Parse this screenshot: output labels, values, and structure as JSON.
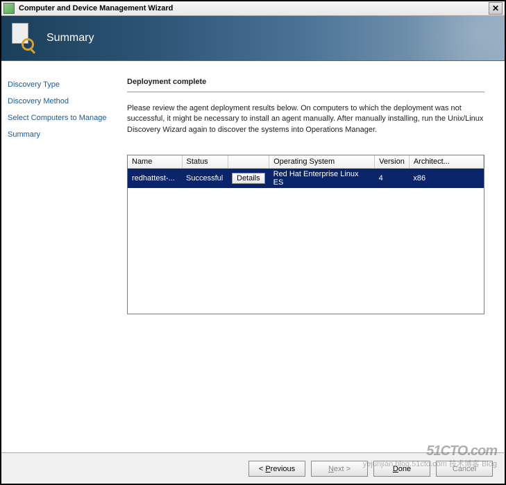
{
  "titlebar": {
    "text": "Computer and Device Management Wizard"
  },
  "header": {
    "title": "Summary"
  },
  "sidebar": {
    "items": [
      {
        "label": "Discovery Type"
      },
      {
        "label": "Discovery Method"
      },
      {
        "label": "Select Computers to Manage"
      },
      {
        "label": "Summary"
      }
    ]
  },
  "main": {
    "section_title": "Deployment complete",
    "description": "Please review the agent deployment results below. On computers to which the deployment was not successful, it might be necessary to install an agent manually. After manually installing, run the Unix/Linux Discovery Wizard again to discover the systems into Operations Manager.",
    "table": {
      "headers": {
        "name": "Name",
        "status": "Status",
        "spacer": "",
        "os": "Operating System",
        "version": "Version",
        "arch": "Architect..."
      },
      "rows": [
        {
          "name": "redhattest-...",
          "status": "Successful",
          "details_label": "Details",
          "os": "Red Hat Enterprise Linux ES",
          "version": "4",
          "arch": "x86"
        }
      ]
    }
  },
  "buttons": {
    "previous": "< Previous",
    "next": "Next >",
    "done": "Done",
    "cancel": "Cancel"
  },
  "labels": {
    "p_char": "P",
    "revious": "revious",
    "n_char": "N",
    "ext": "ext >",
    "d_char": "D",
    "one": "one"
  },
  "watermarks": {
    "logo": "51CTO.com",
    "sub": "yejunjian.blog.51cto.com 技术博客 Blog"
  }
}
